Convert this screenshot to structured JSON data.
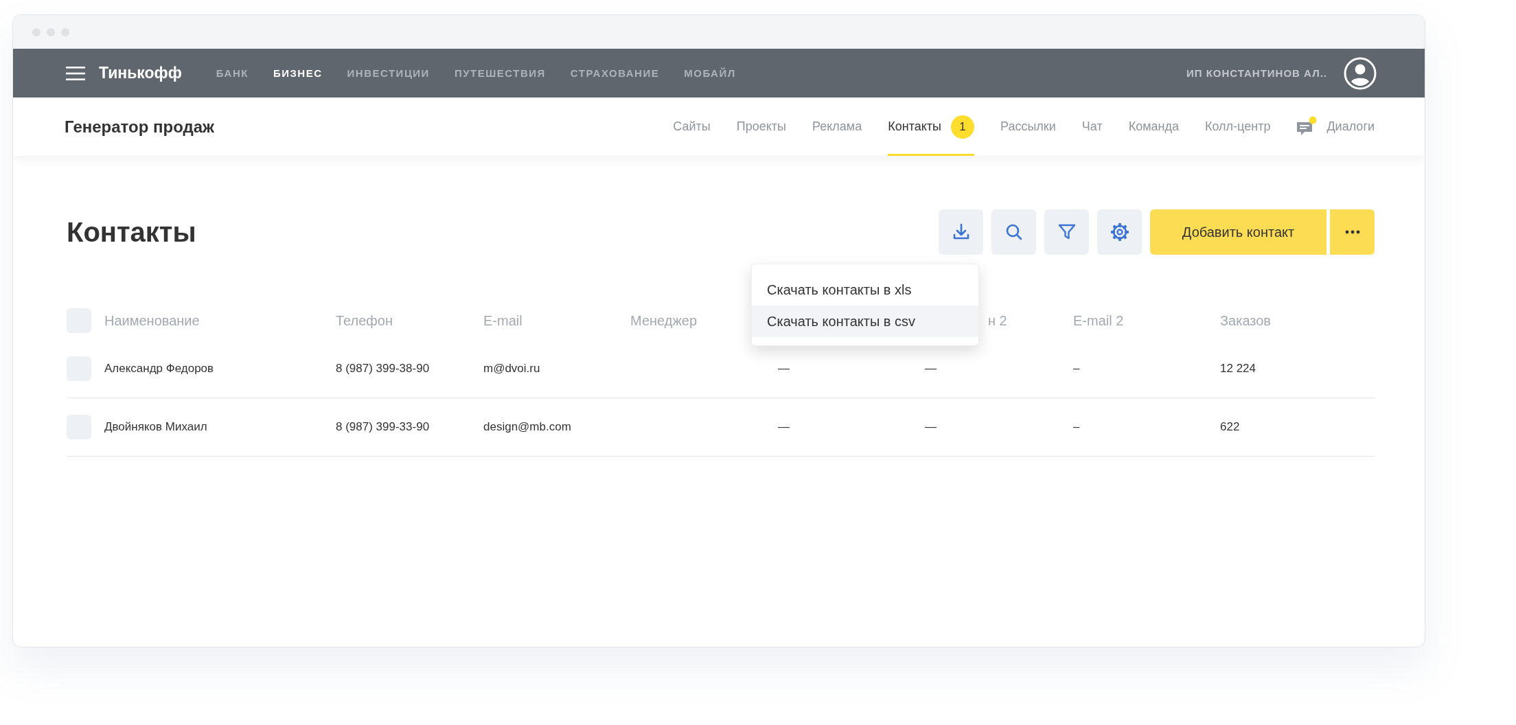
{
  "top_nav": {
    "brand": "Тинькофф",
    "items": [
      {
        "label": "БАНК",
        "selected": false
      },
      {
        "label": "БИЗНЕС",
        "selected": true
      },
      {
        "label": "ИНВЕСТИЦИИ",
        "selected": false
      },
      {
        "label": "ПУТЕШЕСТВИЯ",
        "selected": false
      },
      {
        "label": "СТРАХОВАНИЕ",
        "selected": false
      },
      {
        "label": "МОБАЙЛ",
        "selected": false
      }
    ],
    "user": "ИП КОНСТАНТИНОВ АЛ.."
  },
  "sub_header": {
    "title": "Генератор продаж",
    "tabs": [
      {
        "kind": "text",
        "label": "Сайты",
        "selected": false
      },
      {
        "kind": "text",
        "label": "Проекты",
        "selected": false
      },
      {
        "kind": "text",
        "label": "Реклама",
        "selected": false
      },
      {
        "kind": "text",
        "label": "Контакты",
        "selected": true,
        "badge": "1"
      },
      {
        "kind": "text",
        "label": "Рассылки",
        "selected": false
      },
      {
        "kind": "text",
        "label": "Чат",
        "selected": false
      },
      {
        "kind": "text",
        "label": "Команда",
        "selected": false
      },
      {
        "kind": "text",
        "label": "Колл-центр",
        "selected": false
      },
      {
        "kind": "icon",
        "label": "Диалоги",
        "selected": false,
        "unread": true
      }
    ]
  },
  "page": {
    "title": "Контакты",
    "add_button": "Добавить контакт"
  },
  "export_menu": {
    "items": [
      {
        "label": "Скачать контакты в xls",
        "selected": false
      },
      {
        "label": "Скачать контакты в csv",
        "selected": true
      }
    ]
  },
  "table": {
    "header_checked": false,
    "columns": [
      {
        "label": "Наименование"
      },
      {
        "label": "Телефон"
      },
      {
        "label": "E-mail"
      },
      {
        "label": "Менеджер"
      },
      {},
      {
        "label": "н 2",
        "covered": true
      },
      {
        "label": "E-mail 2"
      },
      {
        "label": "Заказов"
      }
    ],
    "rows": [
      {
        "checked": false,
        "cells": [
          "Александр Федоров",
          "8 (987) 399-38-90",
          "m@dvoi.ru",
          null,
          "—",
          "—",
          "–",
          "12 224"
        ]
      },
      {
        "checked": false,
        "cells": [
          "Двойняков Михаил",
          "8 (987) 399-33-90",
          "design@mb.com",
          null,
          "—",
          "—",
          "–",
          "622"
        ]
      }
    ]
  }
}
